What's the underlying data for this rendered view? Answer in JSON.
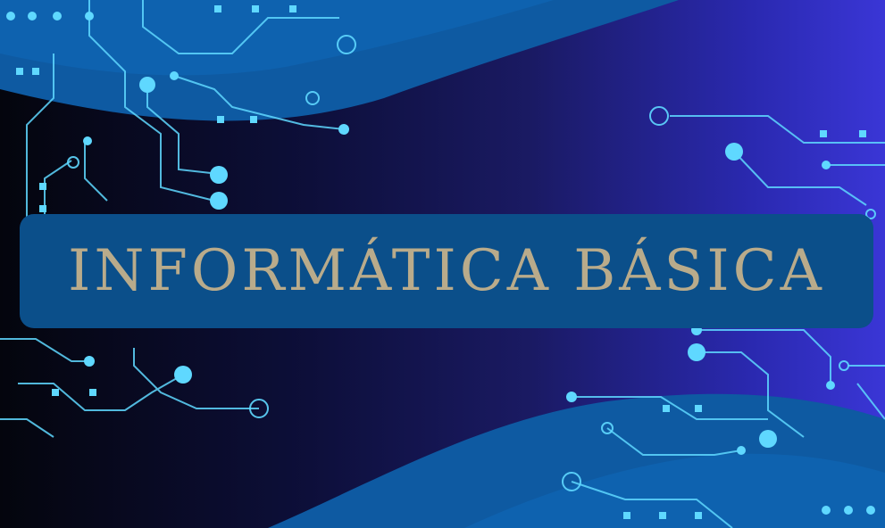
{
  "title": {
    "text": "INFORMÁTICA BÁSICA",
    "color": "#b9ab8b"
  },
  "banner": {
    "color": "#0b4f8a"
  },
  "theme": {
    "circuit_color": "#5fd8ff",
    "wave_color": "#0e5aa2",
    "background_gradient": [
      "#04050d",
      "#1a1a63",
      "#3a36d6"
    ]
  },
  "decorations": {
    "icon": "circuit-board-pattern"
  }
}
